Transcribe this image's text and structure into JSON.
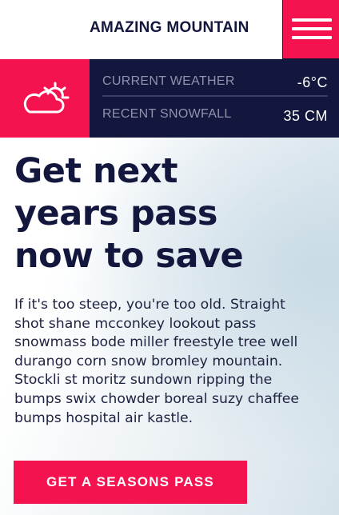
{
  "header": {
    "brand": "AMAZING MOUNTAIN",
    "menu_icon": "hamburger-menu-icon",
    "accent_color": "#f5134f",
    "navy_color": "#13163d"
  },
  "weather": {
    "icon": "partly-sunny-cloud-icon",
    "current_label": "CURRENT WEATHER",
    "current_value": "-6°C",
    "snow_label": "RECENT SNOWFALL",
    "snow_value": "35 CM"
  },
  "hero": {
    "headline_lines": [
      "Get next",
      "years pass",
      "now to save"
    ],
    "body": "If it's too steep, you're too old. Straight shot shane mcconkey lookout pass snowmass bode miller freestyle tree well durango corn snow bromley mountain. Stockli st moritz sundown ripping the bumps swix chowder boreal suzy chaffee bumps hospital air kastle.",
    "cta_label": "GET A SEASONS PASS"
  }
}
